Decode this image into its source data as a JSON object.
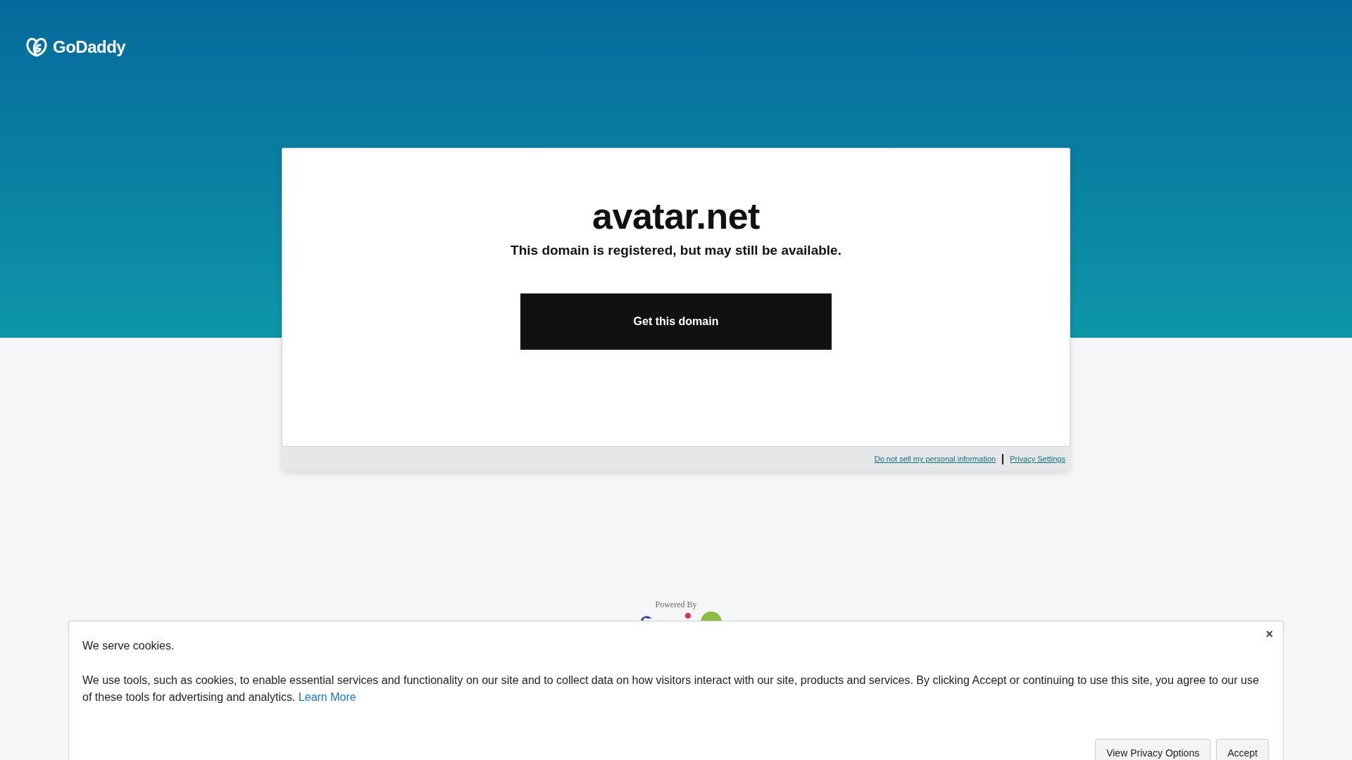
{
  "header": {
    "logo": "GoDaddy"
  },
  "card": {
    "domain": "avatar.net",
    "message": "This domain is registered, but may still be available.",
    "button": "Get this domain"
  },
  "footer_links": [
    "Do not sell my personal information",
    "Privacy Settings"
  ],
  "powered_by": "Powered By",
  "cookie_banner": {
    "title": "We serve cookies.",
    "text": "We use tools, such as cookies, to enable essential services and functionality on our site and to collect data on how visitors interact with our site, products and services. By clicking Accept or continuing to use this site, you agree to our use of these tools for advertising and analytics.",
    "link": "Learn More",
    "close": "×",
    "buttons": [
      "View Privacy Options",
      "Accept"
    ]
  }
}
